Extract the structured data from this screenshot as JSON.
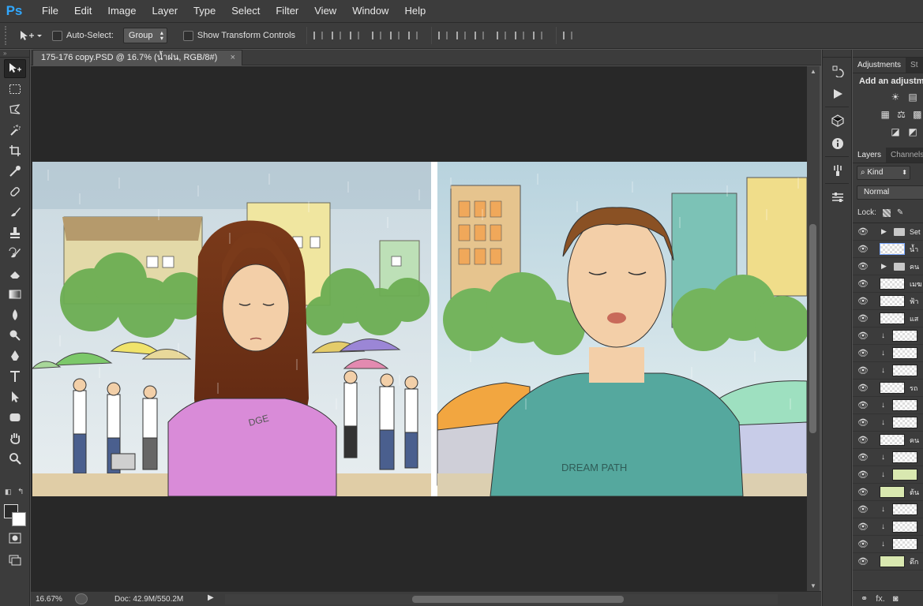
{
  "app": {
    "logo": "Ps"
  },
  "menu": [
    "File",
    "Edit",
    "Image",
    "Layer",
    "Type",
    "Select",
    "Filter",
    "View",
    "Window",
    "Help"
  ],
  "options_bar": {
    "auto_select_label": "Auto-Select:",
    "auto_select_value": "Group",
    "show_transform_label": "Show Transform Controls"
  },
  "document": {
    "tab_title": "175-176 copy.PSD @ 16.7% (น้ำฝน, RGB/8#)",
    "close_glyph": "×"
  },
  "status": {
    "zoom": "16.67%",
    "doc_size": "Doc: 42.9M/550.2M"
  },
  "panels": {
    "adjustments_tab": "Adjustments",
    "styles_tab": "St",
    "adjustments_title": "Add an adjustme",
    "layers_tab": "Layers",
    "channels_tab": "Channels",
    "kind_label": "Kind",
    "blend_mode": "Normal",
    "lock_label": "Lock:",
    "layers": [
      {
        "type": "folder",
        "name": "Set"
      },
      {
        "type": "layer",
        "name": "น้ำ",
        "selected": true
      },
      {
        "type": "folder",
        "name": "คน"
      },
      {
        "type": "layer",
        "name": "เมฆ"
      },
      {
        "type": "layer",
        "name": "ฟ้า"
      },
      {
        "type": "layer",
        "name": "แส"
      },
      {
        "type": "clip",
        "name": ""
      },
      {
        "type": "clip",
        "name": ""
      },
      {
        "type": "clip",
        "name": ""
      },
      {
        "type": "layer",
        "name": "รถ"
      },
      {
        "type": "clip",
        "name": ""
      },
      {
        "type": "clip",
        "name": ""
      },
      {
        "type": "layer",
        "name": "คน"
      },
      {
        "type": "clip",
        "name": ""
      },
      {
        "type": "clip",
        "name": "",
        "green": true
      },
      {
        "type": "layer",
        "name": "ต้น",
        "green": true
      },
      {
        "type": "clip",
        "name": ""
      },
      {
        "type": "clip",
        "name": ""
      },
      {
        "type": "clip",
        "name": ""
      },
      {
        "type": "layer",
        "name": "ตึก",
        "green": true
      }
    ],
    "footer_fx": "fx."
  },
  "artwork": {
    "shirt_text_left": "DGE",
    "shirt_text_right": "DREAM PATH"
  }
}
